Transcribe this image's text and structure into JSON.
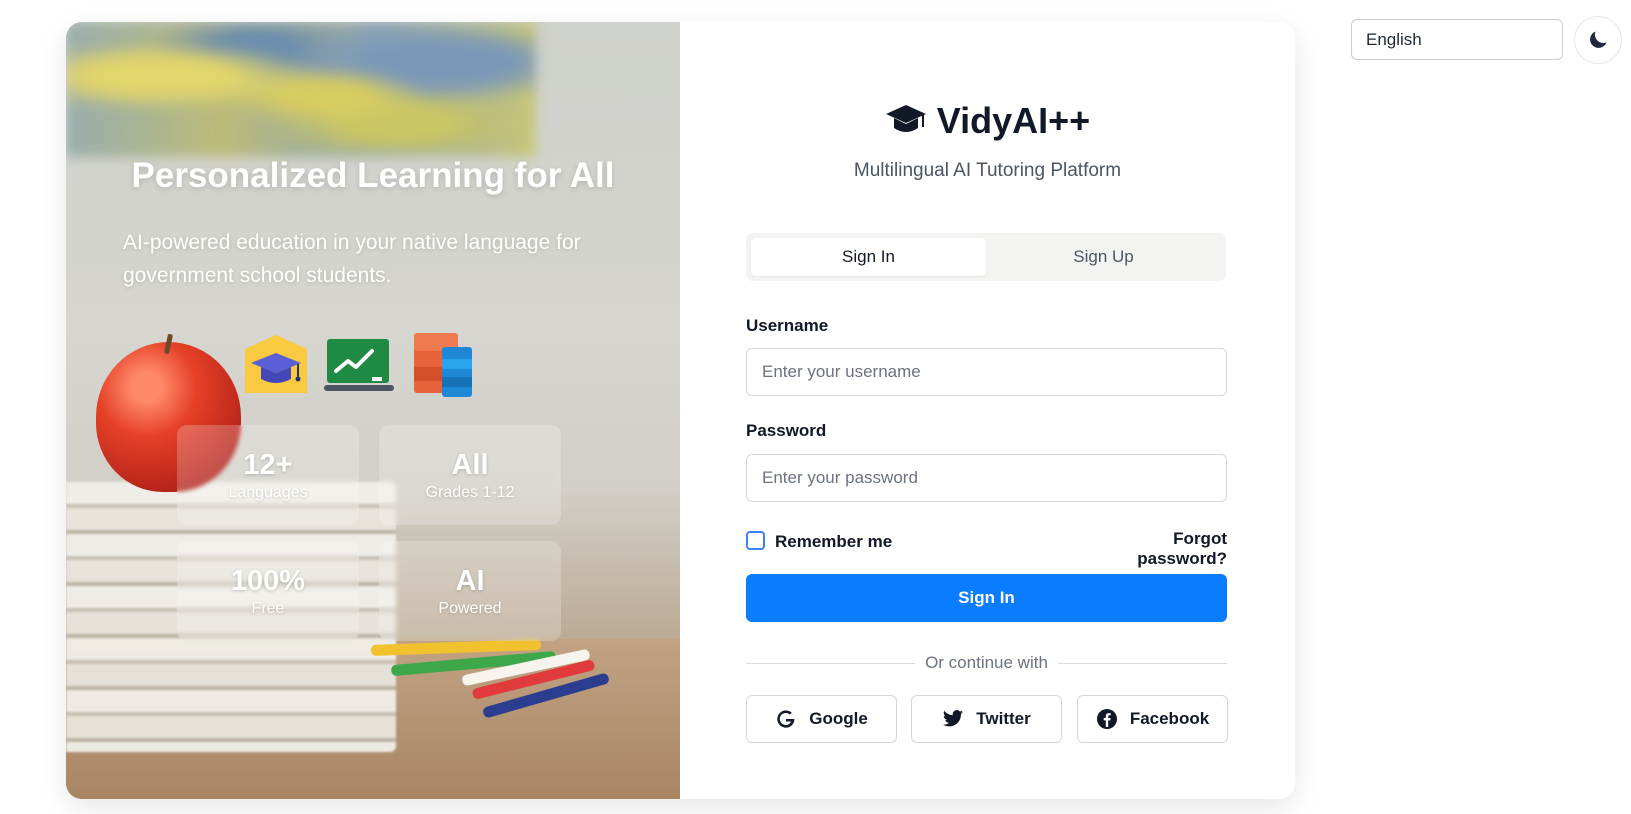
{
  "controls": {
    "language": "English",
    "theme_icon": "moon-icon"
  },
  "hero": {
    "title": "Personalized Learning for All",
    "subtitle": "AI-powered education in your native language for government school students.",
    "icons": [
      "graduation-cap-school-icon",
      "chart-board-icon",
      "devices-icon"
    ],
    "stats": [
      {
        "value": "12+",
        "label": "Languages"
      },
      {
        "value": "All",
        "label": "Grades 1-12"
      },
      {
        "value": "100%",
        "label": "Free"
      },
      {
        "value": "AI",
        "label": "Powered"
      }
    ]
  },
  "brand": {
    "name": "VidyAI++",
    "tagline": "Multilingual AI Tutoring Platform",
    "icon": "graduation-cap-icon"
  },
  "tabs": [
    {
      "label": "Sign In",
      "active": true
    },
    {
      "label": "Sign Up",
      "active": false
    }
  ],
  "form": {
    "username_label": "Username",
    "username_placeholder": "Enter your username",
    "password_label": "Password",
    "password_placeholder": "Enter your password",
    "remember_label": "Remember me",
    "forgot_label": "Forgot password?",
    "submit_label": "Sign In",
    "divider_text": "Or continue with"
  },
  "social": [
    {
      "label": "Google",
      "icon": "google-icon"
    },
    {
      "label": "Twitter",
      "icon": "twitter-icon"
    },
    {
      "label": "Facebook",
      "icon": "facebook-icon"
    }
  ],
  "colors": {
    "primary": "#0a7cff",
    "checkbox_border": "#3b82f6",
    "text": "#111827"
  }
}
